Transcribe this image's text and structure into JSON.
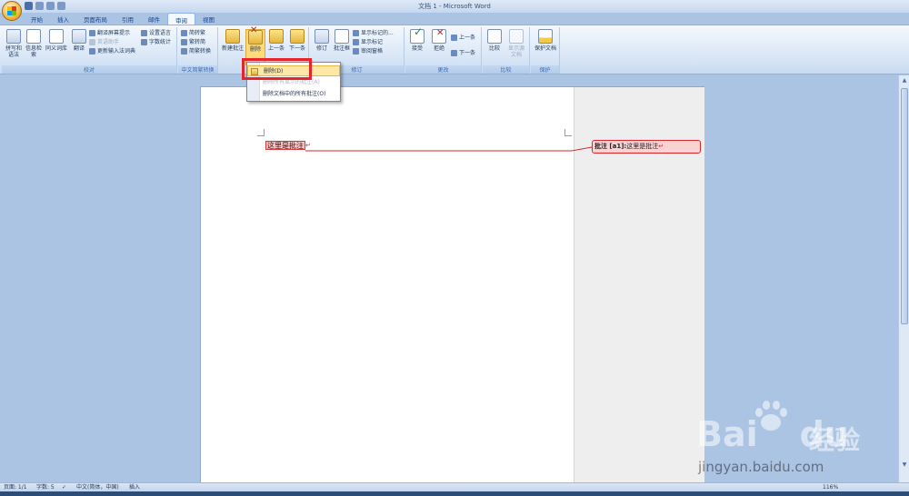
{
  "window": {
    "title": "文档 1 - Microsoft Word"
  },
  "tabs": [
    {
      "label": "开始"
    },
    {
      "label": "插入"
    },
    {
      "label": "页面布局"
    },
    {
      "label": "引用"
    },
    {
      "label": "邮件"
    },
    {
      "label": "审阅",
      "active": true
    },
    {
      "label": "视图"
    }
  ],
  "ribbon": {
    "proofing": {
      "label": "校对",
      "spelling": "拼写和语法",
      "research": "信息检索",
      "thesaurus": "同义词库",
      "translate": "翻译",
      "translate_tip": "翻译屏幕提示",
      "translate_helper": "英语助手",
      "update_ime": "更新输入法词典",
      "set_language": "设置语言",
      "word_count": "字数统计"
    },
    "chinese_conversion": {
      "label": "中文简繁转换",
      "to_traditional": "简转繁",
      "to_simplified": "繁转简",
      "convert": "简繁转换"
    },
    "comments": {
      "new": "新建批注",
      "delete": "删除",
      "previous": "上一条",
      "next": "下一条"
    },
    "tracking": {
      "label": "修订",
      "track_changes": "修订",
      "balloons": "批注框",
      "display_markup": "显示标记的...",
      "show_markup": "显示标记",
      "review_pane": "审阅窗格"
    },
    "changes": {
      "label": "更改",
      "accept": "接受",
      "reject": "拒绝",
      "previous": "上一条",
      "next": "下一条"
    },
    "compare": {
      "label": "比较",
      "compare": "比较",
      "show_source": "显示源文档"
    },
    "protect": {
      "label": "保护",
      "protect_doc": "保护文档"
    }
  },
  "delete_menu": {
    "items": [
      {
        "label": "删除(D)",
        "highlighted": true
      },
      {
        "label": "删除所有显示的批注(A)",
        "disabled": true
      },
      {
        "label": "删除文档中的所有批注(O)"
      }
    ]
  },
  "document": {
    "commented_text": "这里是批注",
    "balloon_label": "批注 [a1]:",
    "balloon_text": "这里是批注",
    "comment_color": "#d7262e"
  },
  "statusbar": {
    "page": "页面: 1/1",
    "words": "字数: 5",
    "language": "中文(简体，中国)",
    "mode": "插入",
    "zoom": "116%"
  },
  "watermark": {
    "brand": "Bai",
    "brand2": "du",
    "jingyan": "经验",
    "url": "jingyan.baidu.com"
  }
}
